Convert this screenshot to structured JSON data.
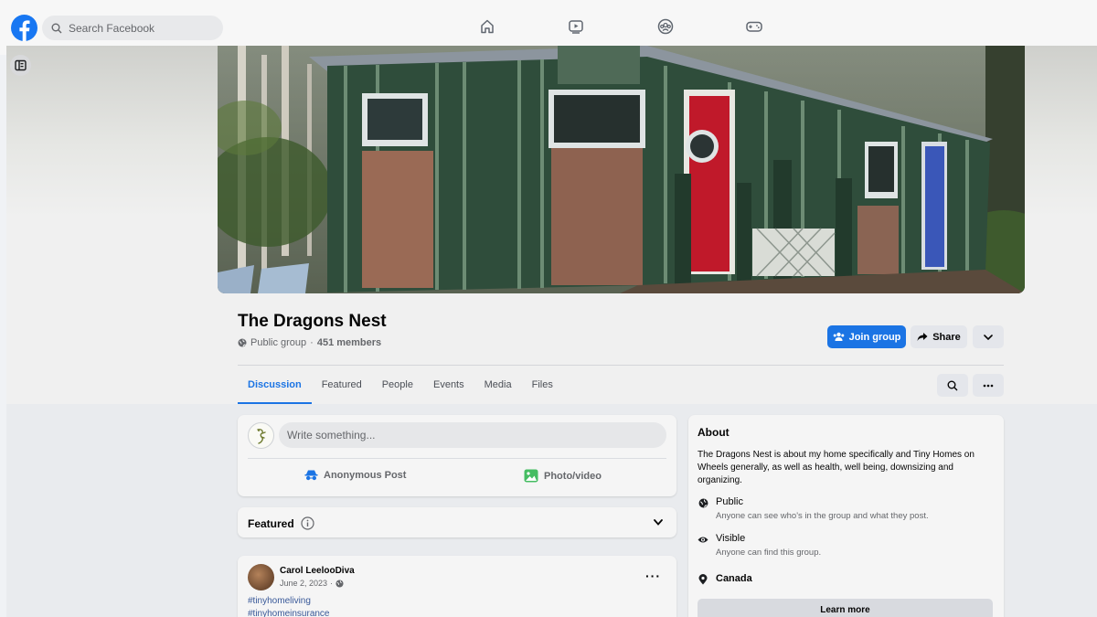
{
  "header": {
    "search_placeholder": "Search Facebook",
    "nav": [
      {
        "icon": "home-icon"
      },
      {
        "icon": "watch-icon"
      },
      {
        "icon": "groups-icon"
      },
      {
        "icon": "gaming-icon"
      }
    ]
  },
  "group": {
    "title": "The Dragons Nest",
    "privacy": "Public group",
    "separator": "·",
    "members": "451 members",
    "join_label": "Join group",
    "share_label": "Share"
  },
  "tabs": [
    {
      "label": "Discussion",
      "active": true
    },
    {
      "label": "Featured"
    },
    {
      "label": "People"
    },
    {
      "label": "Events"
    },
    {
      "label": "Media"
    },
    {
      "label": "Files"
    }
  ],
  "composer": {
    "placeholder": "Write something...",
    "anonymous_label": "Anonymous Post",
    "photo_label": "Photo/video"
  },
  "featured": {
    "label": "Featured"
  },
  "post": {
    "author": "Carol LeelooDiva",
    "date": "June 2, 2023",
    "date_sep": "·",
    "tags": [
      "#tinyhomeliving",
      "#tinyhomeinsurance"
    ]
  },
  "about": {
    "title": "About",
    "description": "The Dragons Nest is about my home specifically and Tiny Homes on Wheels generally, as well as health, well being, downsizing and organizing.",
    "public_title": "Public",
    "public_sub": "Anyone can see who's in the group and what they post.",
    "visible_title": "Visible",
    "visible_sub": "Anyone can find this group.",
    "location": "Canada",
    "learn_more": "Learn more"
  },
  "colors": {
    "brand": "#1877f2",
    "accent": "#1b74e4",
    "page_bg": "#f0f2f5"
  }
}
